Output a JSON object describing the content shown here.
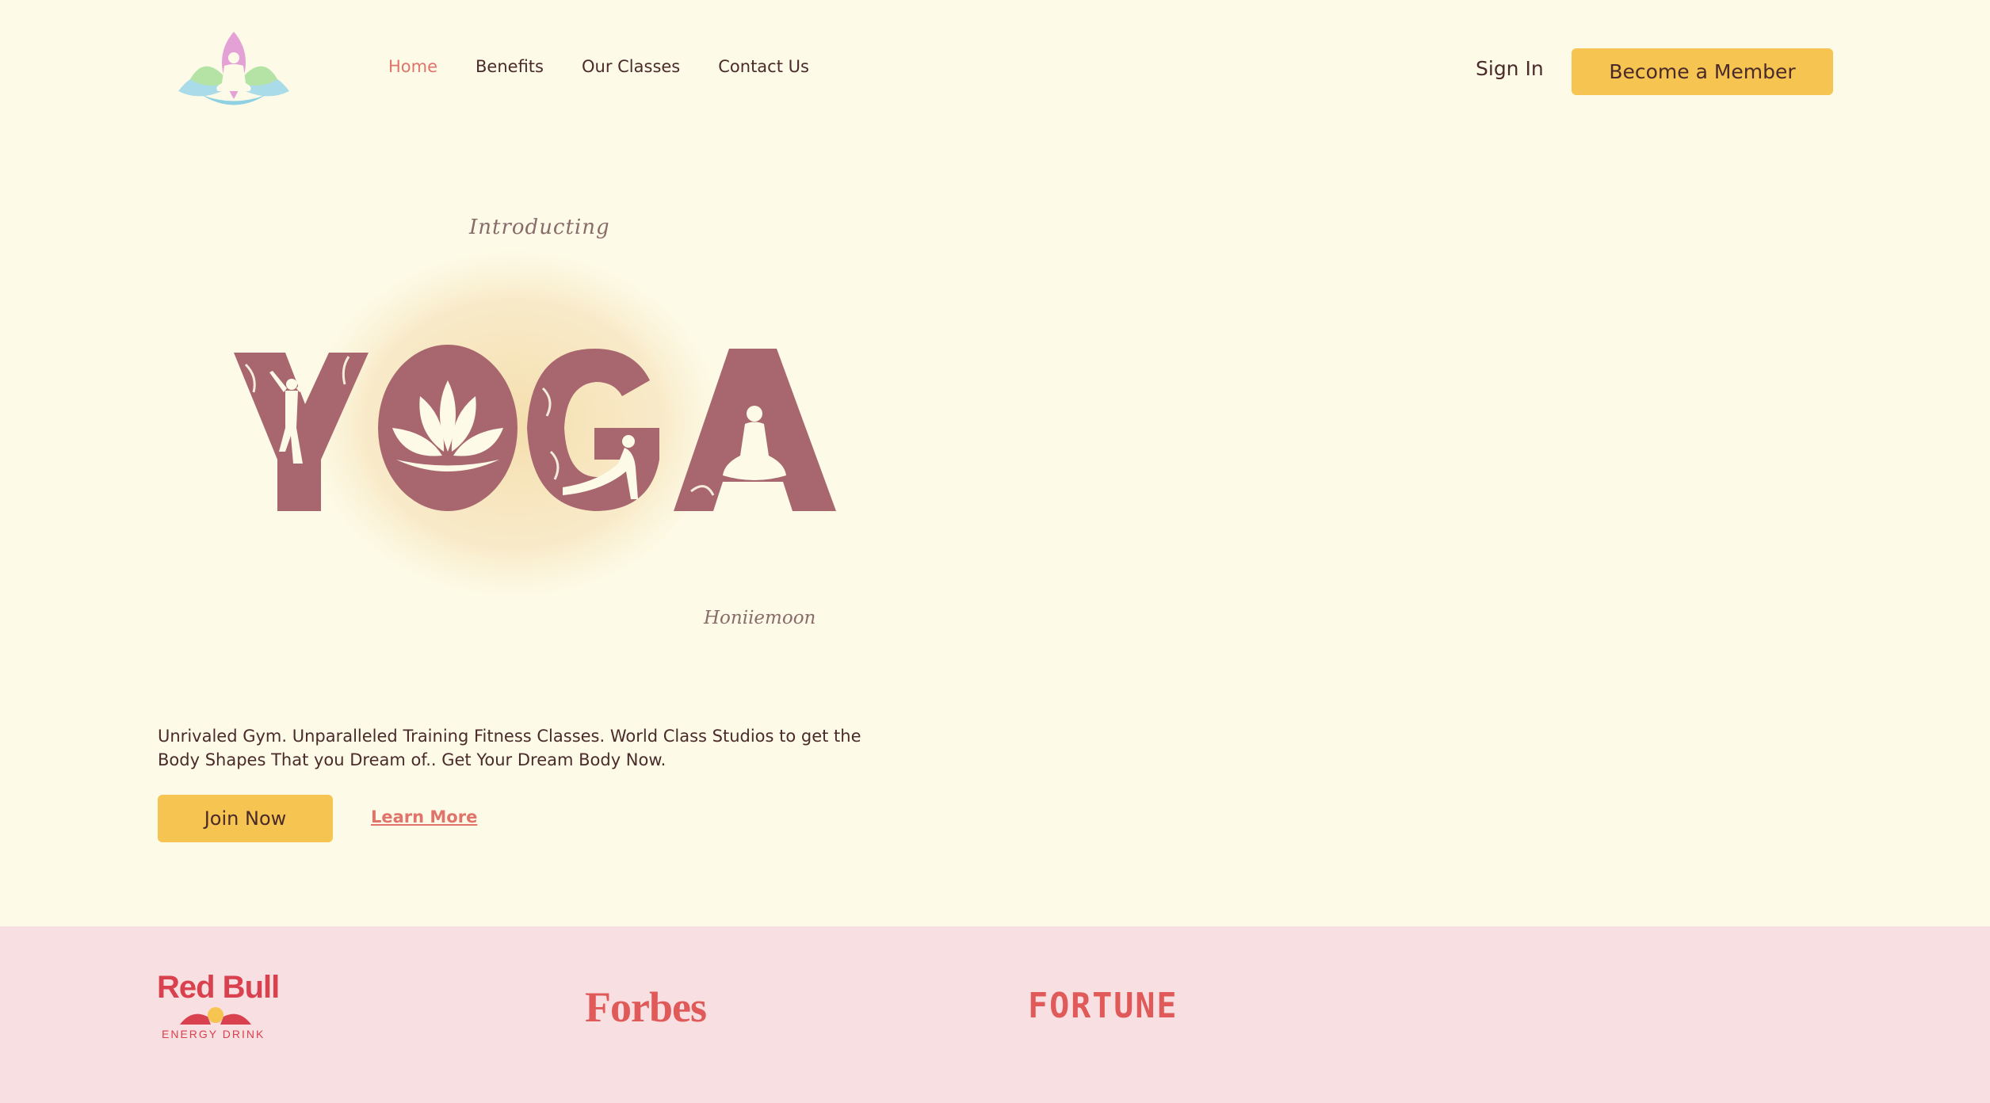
{
  "nav": {
    "links": [
      {
        "label": "Home",
        "active": true
      },
      {
        "label": "Benefits",
        "active": false
      },
      {
        "label": "Our Classes",
        "active": false
      },
      {
        "label": "Contact Us",
        "active": false
      }
    ],
    "sign_in": "Sign In",
    "member_button": "Become a Member"
  },
  "hero": {
    "art_title": "YOGA",
    "art_intro": "Introducting",
    "art_signature": "Honiiemoon",
    "description": "Unrivaled Gym. Unparalleled Training Fitness Classes. World Class Studios to get the Body Shapes That you Dream of.. Get Your Dream Body Now.",
    "join_button": "Join Now",
    "learn_more": "Learn More"
  },
  "partners": {
    "redbull": "Red Bull",
    "redbull_sub": "ENERGY DRINK",
    "forbes": "Forbes",
    "fortune": "FORTUNE"
  },
  "colors": {
    "background": "#fdfbe7",
    "accent": "#f5c451",
    "link_active": "#e0736a",
    "band": "#f8e0e2",
    "yoga_letters": "#a8676e"
  },
  "icons": [
    "lotus-meditation-logo-icon",
    "yoga-pose-icon",
    "lotus-flower-icon",
    "cobra-pose-icon",
    "meditation-pose-icon",
    "red-bull-logo-icon"
  ]
}
